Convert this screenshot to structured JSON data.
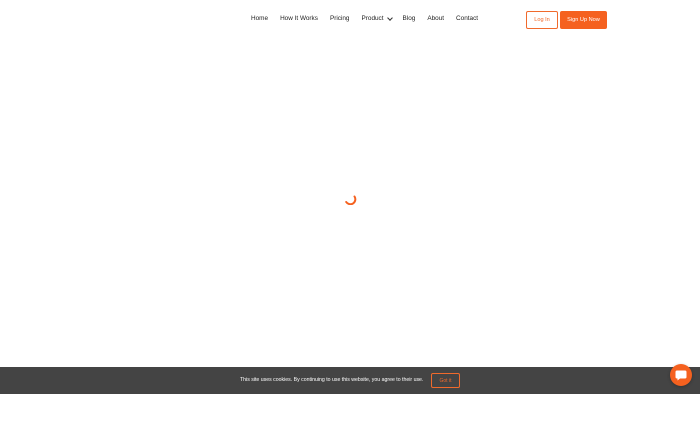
{
  "nav": {
    "items": [
      {
        "label": "Home"
      },
      {
        "label": "How It Works"
      },
      {
        "label": "Pricing"
      },
      {
        "label": "Product"
      },
      {
        "label": "Blog"
      },
      {
        "label": "About"
      },
      {
        "label": "Contact"
      }
    ],
    "login_label": "Log In",
    "signup_label": "Sign Up Now"
  },
  "cookie": {
    "message": "This site uses cookies. By continuing to use this website, you agree to their use.",
    "button_label": "Got it"
  },
  "colors": {
    "accent": "#f5611f",
    "cookie_bar": "#444444"
  },
  "icons": {
    "spinner": "loading-spinner-icon",
    "chat": "chat-bubble-icon",
    "product_dropdown": "chevron-down-icon"
  }
}
